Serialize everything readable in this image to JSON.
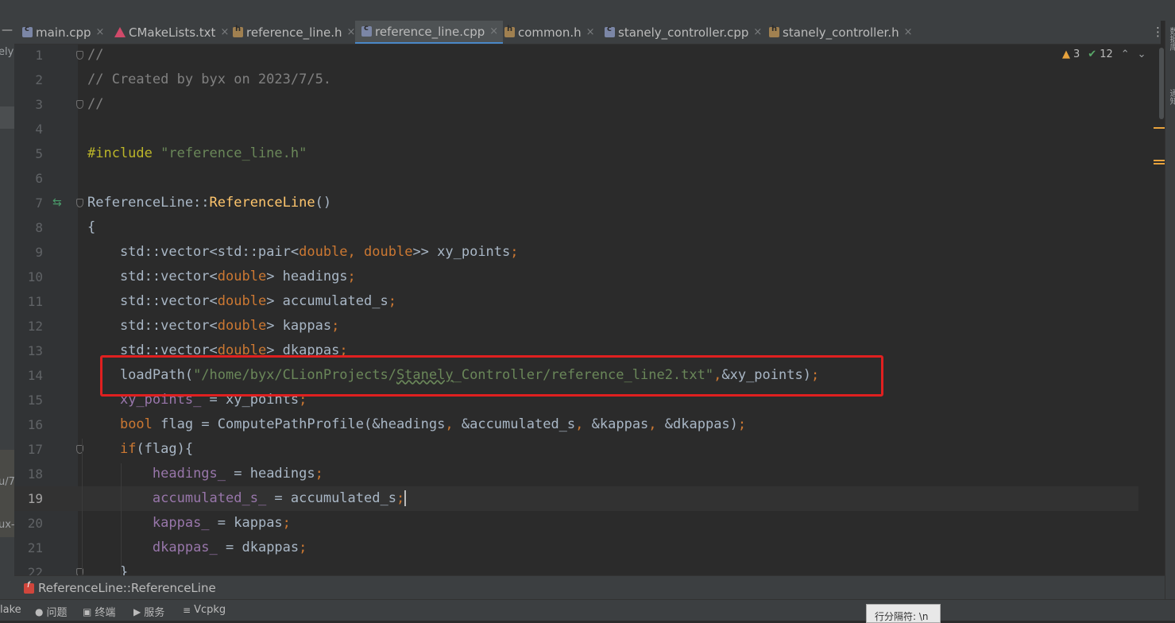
{
  "tabs": [
    {
      "label": "main.cpp",
      "icon": "cpp-file-icon",
      "active": false
    },
    {
      "label": "CMakeLists.txt",
      "icon": "cmake-file-icon",
      "active": false
    },
    {
      "label": "reference_line.h",
      "icon": "header-file-icon",
      "active": false
    },
    {
      "label": "reference_line.cpp",
      "icon": "cpp-file-icon",
      "active": true
    },
    {
      "label": "common.h",
      "icon": "header-file-icon",
      "active": false
    },
    {
      "label": "stanely_controller.cpp",
      "icon": "cpp-file-icon",
      "active": false
    },
    {
      "label": "stanely_controller.h",
      "icon": "header-file-icon",
      "active": false
    }
  ],
  "tab_close_glyph": "×",
  "tab_menu_glyph": "⋮",
  "left_panel": {
    "minus": "—",
    "fragments": [
      "ely",
      "u/7",
      "ux-"
    ]
  },
  "right_panel": {
    "labels": [
      "数据库",
      "通知"
    ]
  },
  "inspections": {
    "warnings": "3",
    "weak_warnings": "12"
  },
  "editor": {
    "current_line": 19,
    "lines": [
      {
        "n": "1",
        "segs": [
          {
            "t": "//",
            "c": "c-comment"
          }
        ]
      },
      {
        "n": "2",
        "segs": [
          {
            "t": "// Created by byx on 2023/7/5.",
            "c": "c-comment"
          }
        ]
      },
      {
        "n": "3",
        "segs": [
          {
            "t": "//",
            "c": "c-comment"
          }
        ]
      },
      {
        "n": "4",
        "segs": []
      },
      {
        "n": "5",
        "segs": [
          {
            "t": "#include ",
            "c": "c-pp"
          },
          {
            "t": "\"reference_line.h\"",
            "c": "c-str"
          }
        ]
      },
      {
        "n": "6",
        "segs": []
      },
      {
        "n": "7",
        "segs": [
          {
            "t": "ReferenceLine::",
            "c": ""
          },
          {
            "t": "ReferenceLine",
            "c": "c-fn"
          },
          {
            "t": "()",
            "c": ""
          }
        ]
      },
      {
        "n": "8",
        "segs": [
          {
            "t": "{",
            "c": ""
          }
        ]
      },
      {
        "n": "9",
        "segs": [
          {
            "t": "    std::vector<std::pair<",
            "c": ""
          },
          {
            "t": "double",
            "c": "c-kw"
          },
          {
            "t": ", ",
            "c": "c-kw"
          },
          {
            "t": "double",
            "c": "c-kw"
          },
          {
            "t": ">> xy_points",
            "c": ""
          },
          {
            "t": ";",
            "c": "c-kw"
          }
        ]
      },
      {
        "n": "10",
        "segs": [
          {
            "t": "    std::vector<",
            "c": ""
          },
          {
            "t": "double",
            "c": "c-kw"
          },
          {
            "t": "> headings",
            "c": ""
          },
          {
            "t": ";",
            "c": "c-kw"
          }
        ]
      },
      {
        "n": "11",
        "segs": [
          {
            "t": "    std::vector<",
            "c": ""
          },
          {
            "t": "double",
            "c": "c-kw"
          },
          {
            "t": "> accumulated_s",
            "c": ""
          },
          {
            "t": ";",
            "c": "c-kw"
          }
        ]
      },
      {
        "n": "12",
        "segs": [
          {
            "t": "    std::vector<",
            "c": ""
          },
          {
            "t": "double",
            "c": "c-kw"
          },
          {
            "t": "> kappas",
            "c": ""
          },
          {
            "t": ";",
            "c": "c-kw"
          }
        ]
      },
      {
        "n": "13",
        "segs": [
          {
            "t": "    std::vector<",
            "c": ""
          },
          {
            "t": "double",
            "c": "c-kw"
          },
          {
            "t": "> dkappas",
            "c": ""
          },
          {
            "t": ";",
            "c": "c-kw"
          }
        ]
      },
      {
        "n": "14",
        "segs": [
          {
            "t": "    loadPath(",
            "c": ""
          },
          {
            "t": "\"/home/byx/CLionProjects/",
            "c": "c-str"
          },
          {
            "t": "Stanely",
            "c": "c-str c-under"
          },
          {
            "t": "_Controller/reference_line2.txt\"",
            "c": "c-str"
          },
          {
            "t": ",",
            "c": "c-kw"
          },
          {
            "t": "&xy_points)",
            "c": ""
          },
          {
            "t": ";",
            "c": "c-kw"
          }
        ]
      },
      {
        "n": "15",
        "segs": [
          {
            "t": "    ",
            "c": ""
          },
          {
            "t": "xy_points_",
            "c": "c-field"
          },
          {
            "t": " = xy_points",
            "c": ""
          },
          {
            "t": ";",
            "c": "c-kw"
          }
        ]
      },
      {
        "n": "16",
        "segs": [
          {
            "t": "    ",
            "c": ""
          },
          {
            "t": "bool",
            "c": "c-kw"
          },
          {
            "t": " flag = ComputePathProfile(&headings",
            "c": ""
          },
          {
            "t": ", ",
            "c": "c-kw"
          },
          {
            "t": "&accumulated_s",
            "c": ""
          },
          {
            "t": ", ",
            "c": "c-kw"
          },
          {
            "t": "&kappas",
            "c": ""
          },
          {
            "t": ", ",
            "c": "c-kw"
          },
          {
            "t": "&dkappas)",
            "c": ""
          },
          {
            "t": ";",
            "c": "c-kw"
          }
        ]
      },
      {
        "n": "17",
        "segs": [
          {
            "t": "    ",
            "c": ""
          },
          {
            "t": "if",
            "c": "c-kw"
          },
          {
            "t": "(flag){",
            "c": ""
          }
        ]
      },
      {
        "n": "18",
        "segs": [
          {
            "t": "        ",
            "c": ""
          },
          {
            "t": "headings_",
            "c": "c-field"
          },
          {
            "t": " = headings",
            "c": ""
          },
          {
            "t": ";",
            "c": "c-kw"
          }
        ]
      },
      {
        "n": "19",
        "segs": [
          {
            "t": "        ",
            "c": ""
          },
          {
            "t": "accumulated_s_",
            "c": "c-field"
          },
          {
            "t": " = accumulated_s",
            "c": ""
          },
          {
            "t": ";",
            "c": "c-kw"
          }
        ]
      },
      {
        "n": "20",
        "segs": [
          {
            "t": "        ",
            "c": ""
          },
          {
            "t": "kappas_",
            "c": "c-field"
          },
          {
            "t": " = kappas",
            "c": ""
          },
          {
            "t": ";",
            "c": "c-kw"
          }
        ]
      },
      {
        "n": "21",
        "segs": [
          {
            "t": "        ",
            "c": ""
          },
          {
            "t": "dkappas_",
            "c": "c-field"
          },
          {
            "t": " = dkappas",
            "c": ""
          },
          {
            "t": ";",
            "c": "c-kw"
          }
        ]
      },
      {
        "n": "22",
        "segs": [
          {
            "t": "    }",
            "c": ""
          }
        ]
      }
    ]
  },
  "breadcrumb": {
    "label": "ReferenceLine::ReferenceLine",
    "icon": "function-icon"
  },
  "bottom_tools": [
    {
      "label": "lake",
      "icon": ""
    },
    {
      "label": "问题",
      "icon": "problems-icon"
    },
    {
      "label": "终端",
      "icon": "terminal-icon"
    },
    {
      "label": "服务",
      "icon": "services-icon"
    },
    {
      "label": "Vcpkg",
      "icon": "vcpkg-icon"
    }
  ],
  "status_popup": "行分隔符: \\n",
  "colors": {
    "accent": "#4a88c7",
    "highlight_box": "#e02020",
    "warning": "#e8a33d",
    "ok": "#59a869"
  }
}
